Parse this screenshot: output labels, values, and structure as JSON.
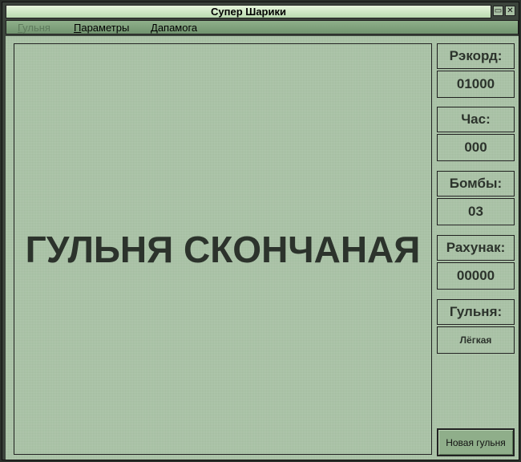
{
  "window": {
    "title": "Супер Шарики",
    "minimize_icon": "minimize-icon",
    "close_icon": "close-icon"
  },
  "menu": [
    {
      "label": "Гульня",
      "mnemonic": "Г",
      "rest": "ульня",
      "enabled": false
    },
    {
      "label": "Параметры",
      "mnemonic": "П",
      "rest": "араметры",
      "enabled": true
    },
    {
      "label": "Дапамога",
      "mnemonic": "Д",
      "rest": "апамога",
      "enabled": true
    }
  ],
  "game": {
    "status": "ГУЛЬНЯ СКОНЧАНАЯ"
  },
  "stats": {
    "record_label": "Рэкорд:",
    "record_value": "01000",
    "time_label": "Час:",
    "time_value": "000",
    "bombs_label": "Бомбы:",
    "bombs_value": "03",
    "score_label": "Рахунак:",
    "score_value": "00000",
    "level_label": "Гульня:",
    "level_value": "Лёгкая"
  },
  "new_game_button": "Новая гульня"
}
